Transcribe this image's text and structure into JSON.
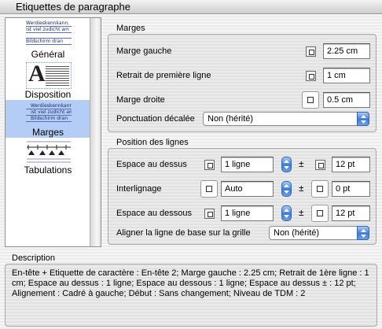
{
  "window": {
    "title": "Etiquettes de paragraphe"
  },
  "sidebar": {
    "items": [
      {
        "label": "Général",
        "thumb": [
          "Werdieskennkann,",
          "ist viel zudicht am",
          "",
          "Bildschirm dran"
        ],
        "selected": false
      },
      {
        "label": "Disposition",
        "thumb_letter": "A",
        "selected": false
      },
      {
        "label": "Marges",
        "thumb": [
          "Werdieskennkann,",
          "ist viel zudicht am",
          "Bildschirm dran"
        ],
        "selected": true
      },
      {
        "label": "Tabulations",
        "selected": false
      }
    ]
  },
  "marges": {
    "title": "Marges",
    "gauche": {
      "label": "Marge gauche",
      "value": "2.25 cm"
    },
    "retrait": {
      "label": "Retrait de première ligne",
      "value": "1 cm"
    },
    "droite": {
      "label": "Marge droite",
      "value": "0.5 cm"
    },
    "ponctuation": {
      "label": "Ponctuation décalée",
      "value": "Non (hérité)"
    }
  },
  "position": {
    "title": "Position des lignes",
    "pm": "±",
    "dessus": {
      "label": "Espace au dessus",
      "value": "1 ligne",
      "tolerance": "12 pt"
    },
    "interlignage": {
      "label": "Interlignage",
      "value": "Auto",
      "tolerance": "0 pt"
    },
    "dessous": {
      "label": "Espace au dessous",
      "value": "1 ligne",
      "tolerance": "12 pt"
    },
    "grille": {
      "label": "Aligner la ligne de base sur la grille",
      "value": "Non (hérité)"
    }
  },
  "description": {
    "title": "Description",
    "text": "En-tête + Etiquette de caractère  : En-tête 2; Marge gauche  : 2.25 cm; Retrait de 1ère ligne  : 1 cm; Espace au dessus  : 1 ligne; Espace au dessous  : 1 ligne; Espace au dessus ±  : 12 pt; Alignement  : Cadré à gauche; Début  : Sans changement; Niveau de TDM  : 2"
  },
  "colors": {
    "selection": "#b4cdf7",
    "accent": "#3b7bd9"
  }
}
